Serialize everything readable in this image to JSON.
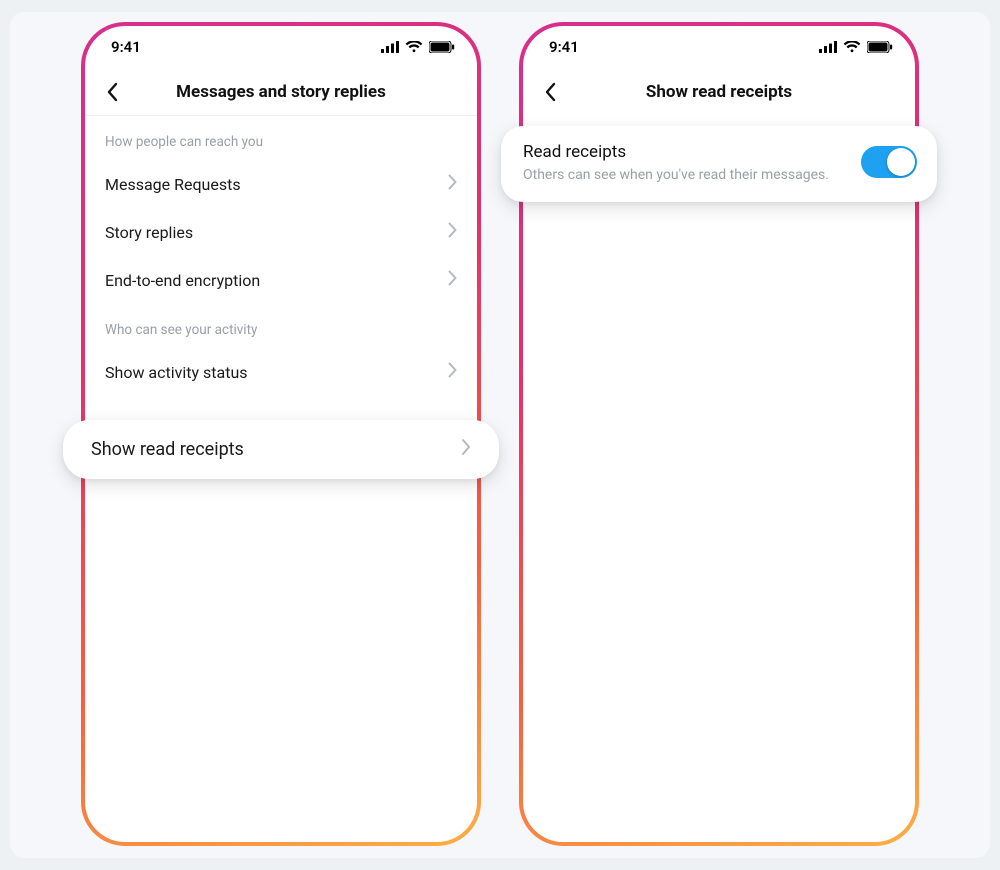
{
  "status": {
    "time": "9:41"
  },
  "left": {
    "title": "Messages and story replies",
    "section1": "How people can reach you",
    "rows1": [
      {
        "label": "Message Requests"
      },
      {
        "label": "Story replies"
      },
      {
        "label": "End-to-end encryption"
      }
    ],
    "section2": "Who can see your activity",
    "rows2": [
      {
        "label": "Show activity status"
      }
    ],
    "highlight": {
      "label": "Show read receipts"
    }
  },
  "right": {
    "title": "Show read receipts",
    "card": {
      "title": "Read receipts",
      "subtitle": "Others can see when you've read their messages.",
      "toggle_on": true
    }
  }
}
